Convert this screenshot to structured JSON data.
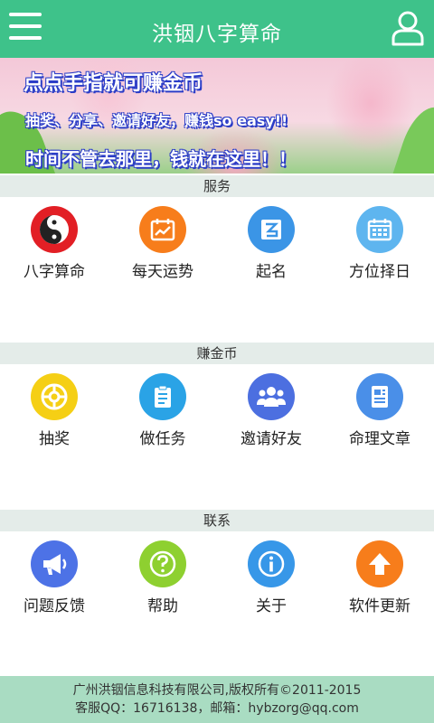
{
  "header": {
    "title": "洪铟八字算命"
  },
  "banner": {
    "line1": "点点手指就可赚金币",
    "line2": "抽奖、分享、邀请好友，赚钱so easy!!",
    "line3": "时间不管去那里，钱就在这里！！"
  },
  "sections": [
    {
      "title": "服务",
      "items": [
        {
          "label": "八字算命",
          "icon": "yin-yang-icon",
          "color": "#e21f25"
        },
        {
          "label": "每天运势",
          "icon": "calendar-chart-icon",
          "color": "#f77d1b"
        },
        {
          "label": "起名",
          "icon": "name-tag-icon",
          "color": "#3b95e6"
        },
        {
          "label": "方位择日",
          "icon": "calendar-icon",
          "color": "#5eb5ef"
        }
      ]
    },
    {
      "title": "赚金币",
      "items": [
        {
          "label": "抽奖",
          "icon": "lottery-wheel-icon",
          "color": "#f5cf15"
        },
        {
          "label": "做任务",
          "icon": "clipboard-icon",
          "color": "#2aa3e6"
        },
        {
          "label": "邀请好友",
          "icon": "people-icon",
          "color": "#4c6fe0"
        },
        {
          "label": "命理文章",
          "icon": "article-icon",
          "color": "#4a8fe8"
        }
      ]
    },
    {
      "title": "联系",
      "items": [
        {
          "label": "问题反馈",
          "icon": "megaphone-icon",
          "color": "#4d72e6"
        },
        {
          "label": "帮助",
          "icon": "help-icon",
          "color": "#8ed030"
        },
        {
          "label": "关于",
          "icon": "info-icon",
          "color": "#3797e8"
        },
        {
          "label": "软件更新",
          "icon": "upload-arrow-icon",
          "color": "#f77d1b"
        }
      ]
    }
  ],
  "footer": {
    "line1": "广州洪铟信息科技有限公司,版权所有©2011-2015",
    "line2": "客服QQ：16716138，邮箱：hybzorg@qq.com"
  }
}
